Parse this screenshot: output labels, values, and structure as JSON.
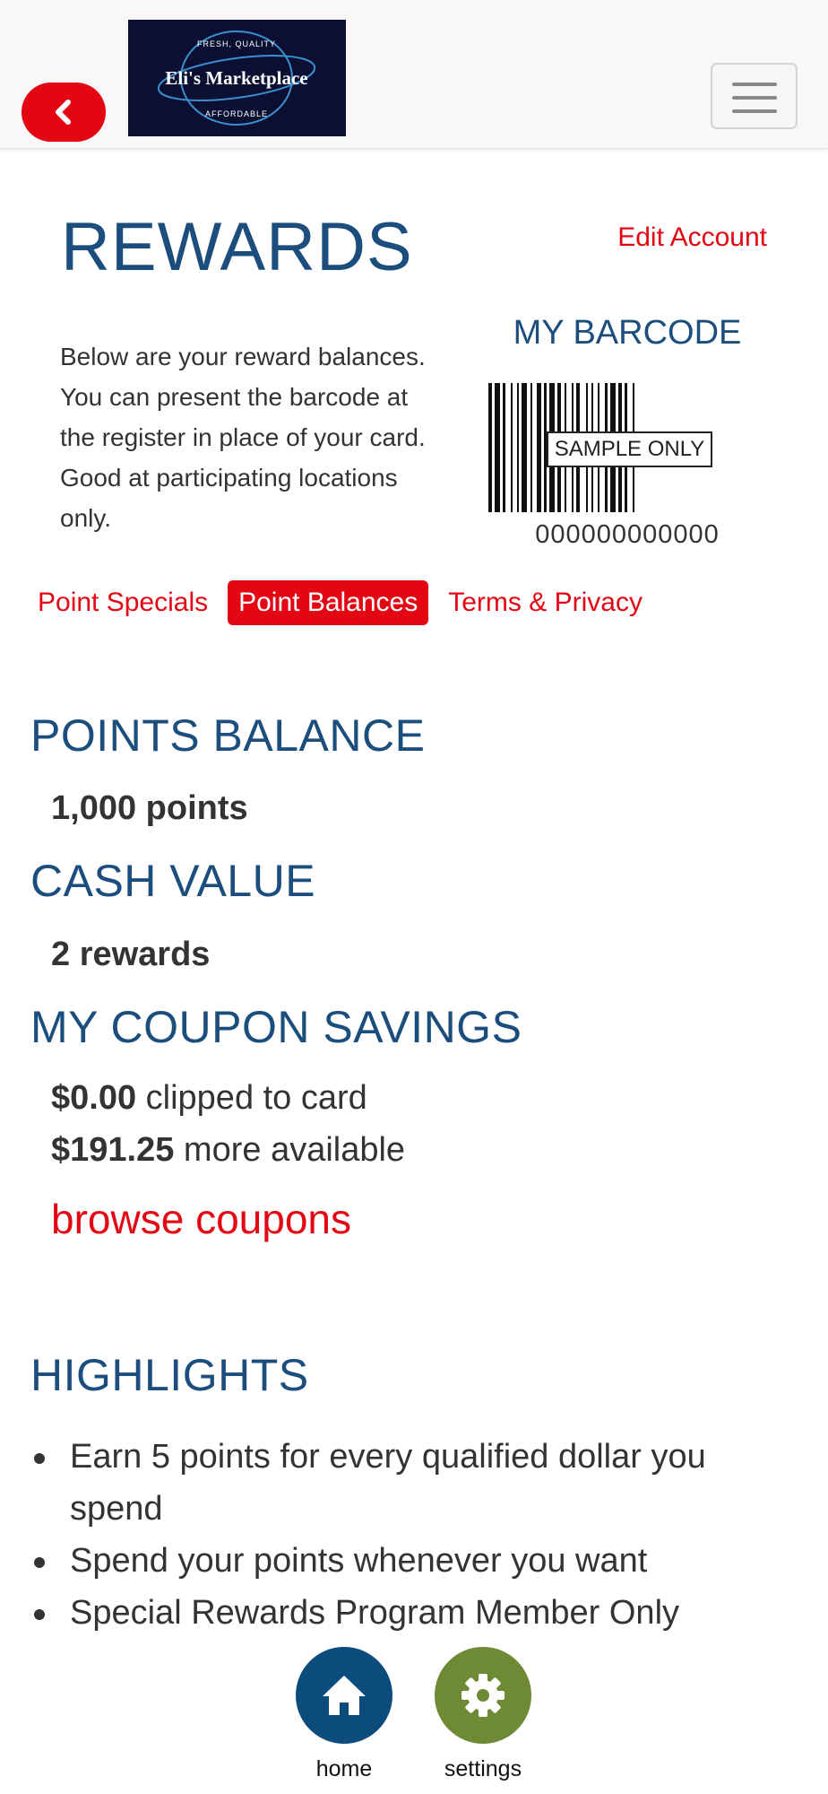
{
  "header": {
    "logo_text": "Eli's Marketplace",
    "logo_tagline_top": "FRESH, QUALITY",
    "logo_tagline_bottom": "AFFORDABLE"
  },
  "rewards": {
    "title": "REWARDS",
    "edit_account": "Edit Account",
    "intro_lines": [
      "Below are your reward balances.",
      "You can present the barcode at",
      "the register in place of your card.",
      "Good at participating locations",
      "only."
    ],
    "barcode_title": "MY BARCODE",
    "barcode_label": "SAMPLE ONLY",
    "barcode_number": "000000000000"
  },
  "tabs": [
    {
      "label": "Point Specials",
      "active": false
    },
    {
      "label": "Point Balances",
      "active": true
    },
    {
      "label": "Terms & Privacy",
      "active": false
    }
  ],
  "points_balance": {
    "heading": "POINTS BALANCE",
    "value": "1,000 points"
  },
  "cash_value": {
    "heading": "CASH VALUE",
    "value": "2 rewards"
  },
  "coupon_savings": {
    "heading": "MY COUPON SAVINGS",
    "clipped_amount": "$0.00",
    "clipped_text": " clipped to card",
    "available_amount": "$191.25",
    "available_text": " more available",
    "browse_link": "browse coupons"
  },
  "highlights": {
    "heading": "HIGHLIGHTS",
    "items": [
      "Earn 5 points for every qualified dollar you spend",
      "Spend your points whenever you want",
      "Special Rewards Program Member Only"
    ]
  },
  "bottom_nav": {
    "home_label": "home",
    "settings_label": "settings",
    "home_color": "#0b4c7d",
    "settings_color": "#6e8a35"
  },
  "colors": {
    "accent_red": "#e30613",
    "heading_blue": "#1b4e7d"
  }
}
